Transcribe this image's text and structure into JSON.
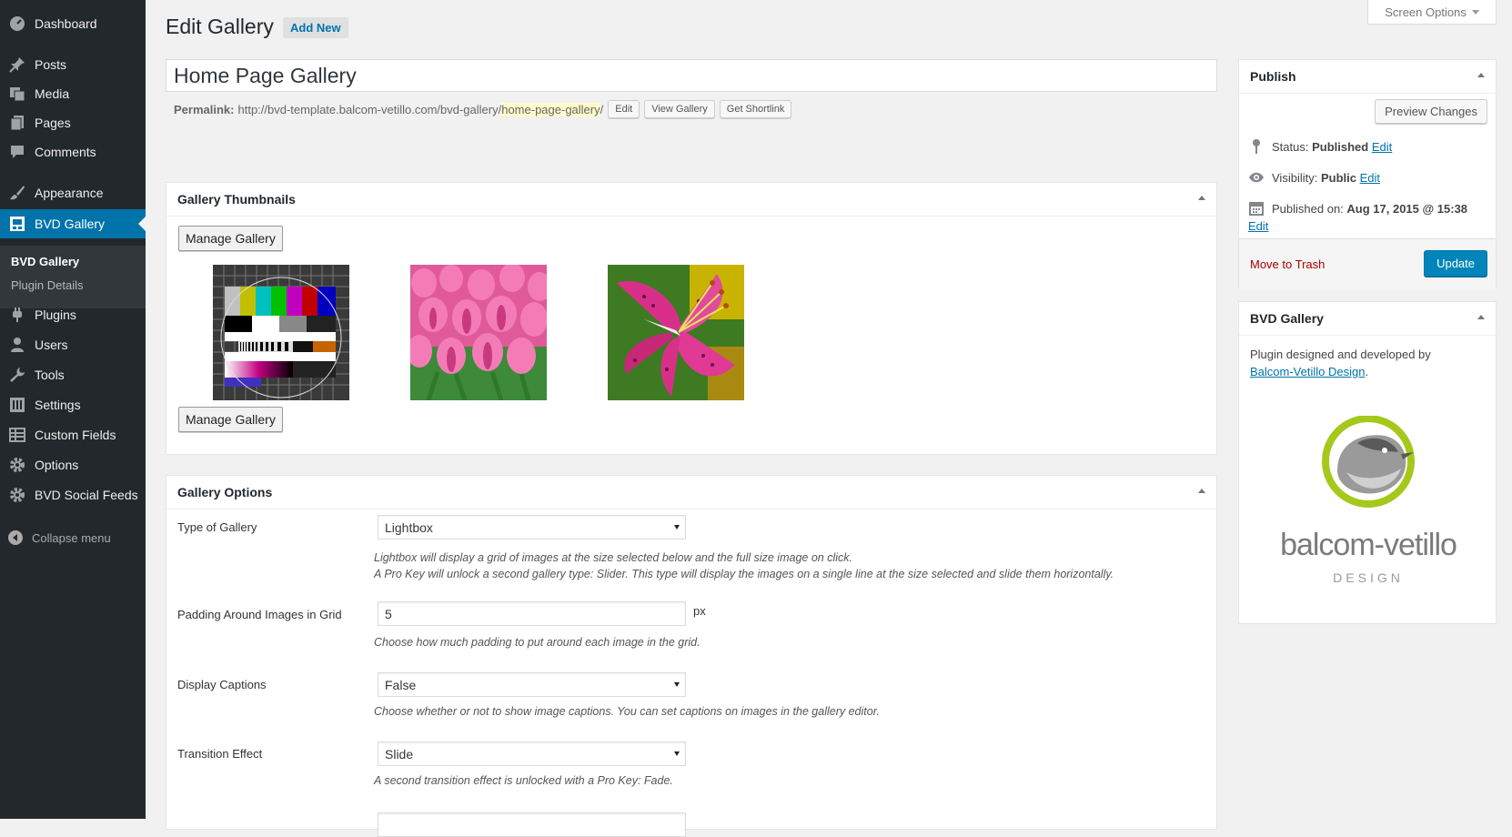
{
  "sidebar": {
    "items": [
      {
        "label": "Dashboard"
      },
      {
        "label": "Posts"
      },
      {
        "label": "Media"
      },
      {
        "label": "Pages"
      },
      {
        "label": "Comments"
      },
      {
        "label": "Appearance"
      },
      {
        "label": "BVD Gallery"
      },
      {
        "label": "Plugins"
      },
      {
        "label": "Users"
      },
      {
        "label": "Tools"
      },
      {
        "label": "Settings"
      },
      {
        "label": "Custom Fields"
      },
      {
        "label": "Options"
      },
      {
        "label": "BVD Social Feeds"
      }
    ],
    "submenu": [
      "BVD Gallery",
      "Plugin Details"
    ],
    "collapse": "Collapse menu",
    "colors": {
      "bg": "#23282d",
      "active": "#0073aa",
      "submenu_bg": "#32373c"
    }
  },
  "header": {
    "title": "Edit Gallery",
    "add_new": "Add New",
    "screen_options": "Screen Options"
  },
  "post": {
    "title": "Home Page Gallery",
    "permalink_label": "Permalink:",
    "permalink_base": "http://bvd-template.balcom-vetillo.com/bvd-gallery/",
    "permalink_slug": "home-page-gallery",
    "permalink_end": "/",
    "edit_btn": "Edit",
    "view_btn": "View Gallery",
    "shortlink_btn": "Get Shortlink"
  },
  "thumbnails": {
    "title": "Gallery Thumbnails",
    "manage_label": "Manage Gallery",
    "images": [
      "test-pattern",
      "pink-tulips",
      "pink-lily"
    ]
  },
  "options": {
    "title": "Gallery Options",
    "type_label": "Type of Gallery",
    "type_value": "Lightbox",
    "type_desc1": "Lightbox will display a grid of images at the size selected below and the full size image on click.",
    "type_desc2": "A Pro Key will unlock a second gallery type: Slider. This type will display the images on a single line at the size selected and slide them horizontally.",
    "padding_label": "Padding Around Images in Grid",
    "padding_value": "5",
    "padding_unit": "px",
    "padding_desc": "Choose how much padding to put around each image in the grid.",
    "captions_label": "Display Captions",
    "captions_value": "False",
    "captions_desc": "Choose whether or not to show image captions. You can set captions on images in the gallery editor.",
    "transition_label": "Transition Effect",
    "transition_value": "Slide",
    "transition_desc": "A second transition effect is unlocked with a Pro Key: Fade."
  },
  "publish": {
    "title": "Publish",
    "preview": "Preview Changes",
    "status_label": "Status:",
    "status_value": "Published",
    "visibility_label": "Visibility:",
    "visibility_value": "Public",
    "published_label": "Published on:",
    "published_value": "Aug 17, 2015 @ 15:38",
    "edit_link": "Edit",
    "trash": "Move to Trash",
    "update": "Update"
  },
  "bvd_box": {
    "title": "BVD Gallery",
    "text": "Plugin designed and developed by",
    "link": "Balcom-Vetillo Design",
    "period": ".",
    "logo_name": "balcom-vetillo",
    "logo_sub": "DESIGN",
    "logo_color": "#a5c81b"
  }
}
